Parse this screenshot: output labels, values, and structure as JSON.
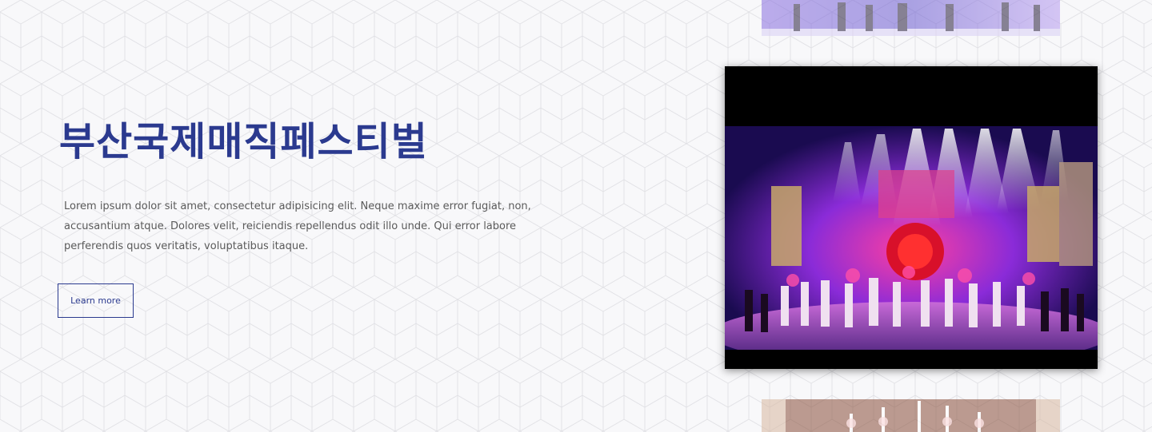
{
  "hero": {
    "title": "부산국제매직페스티벌",
    "description": "Lorem ipsum dolor sit amet, consectetur adipisicing elit. Neque maxime error fugiat, non, accusantium atque. Dolores velit, reiciendis repellendus odit illo unde. Qui error labore perferendis quos veritatis, voluptatibus itaque.",
    "cta_label": "Learn more"
  },
  "colors": {
    "accent": "#2b3a8f",
    "text": "#5a5a5a",
    "background": "#f8f8fa"
  }
}
